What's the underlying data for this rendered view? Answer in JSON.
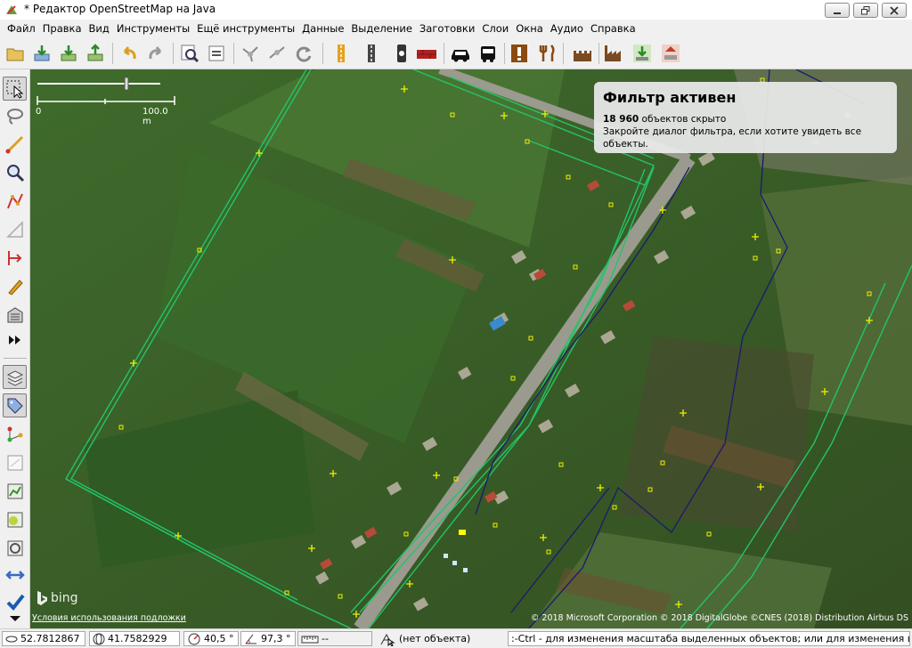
{
  "window": {
    "title": "* Редактор OpenStreetMap на Java"
  },
  "menu": [
    "Файл",
    "Правка",
    "Вид",
    "Инструменты",
    "Ещё инструменты",
    "Данные",
    "Выделение",
    "Заготовки",
    "Слои",
    "Окна",
    "Аудио",
    "Справка"
  ],
  "toolbar": {
    "icons": [
      "open-icon",
      "download-icon",
      "download-area-icon",
      "upload-icon",
      "undo-icon",
      "redo-icon",
      "zoom-selection-icon",
      "preferences-icon",
      "merge-nodes-icon",
      "split-way-icon",
      "refresh-icon",
      "road-icon",
      "highway-icon",
      "traffic-signal-icon",
      "barrier-icon",
      "car-icon",
      "bus-icon",
      "warning-icon",
      "restaurant-icon",
      "castle-icon",
      "factory-icon",
      "landuse-icon",
      "building-icon"
    ]
  },
  "lefttoolbar": {
    "icons": [
      "select-tool-icon",
      "lasso-icon",
      "draw-tool-icon",
      "zoom-tool-icon",
      "improve-way-icon",
      "parallel-icon",
      "split-icon",
      "pencil-icon",
      "building-tool-icon",
      "more-icon",
      "layers-icon",
      "tag-icon",
      "relation-icon",
      "history-icon",
      "changeset-icon",
      "conflict-icon",
      "filter-icon",
      "validation-icon",
      "check-icon"
    ]
  },
  "map": {
    "scale": {
      "zero": "0",
      "max": "100.0 m"
    },
    "filter": {
      "title": "Фильтр активен",
      "hidden_count": "18 960",
      "hidden_text": "объектов скрыто",
      "hint": "Закройте диалог фильтра, если хотите увидеть все объекты."
    },
    "bing_label": "bing",
    "terms": "Условия использования подложки",
    "copyright": "© 2018 Microsoft Corporation © 2018 DigitalGlobe ©CNES (2018) Distribution Airbus DS"
  },
  "status": {
    "lat": "52.7812867",
    "lon": "41.7582929",
    "heading": "40,5 °",
    "angle": "97,3 °",
    "distance": "--",
    "object": "(нет объекта)",
    "help": ":-Ctrl - для изменения масштаба выделенных объектов; или для изменения выделения"
  },
  "colors": {
    "way_green": "#22c46a",
    "way_navy": "#1a1a6e",
    "node_yellow": "#f0f000",
    "road_gray": "#9a9a8e"
  }
}
